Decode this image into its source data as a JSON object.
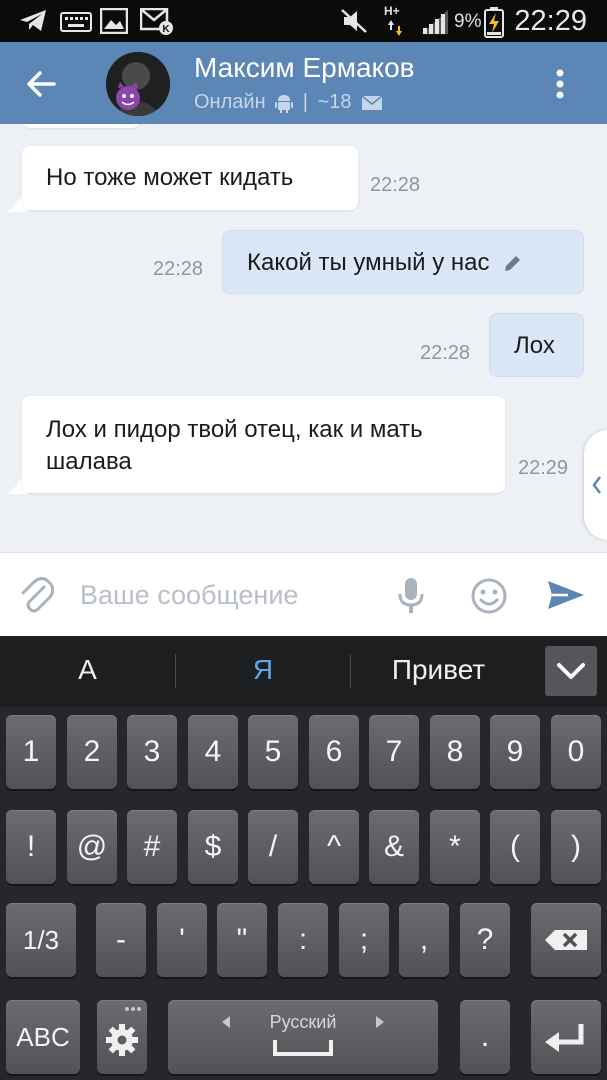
{
  "status_bar": {
    "icons": [
      "telegram-icon",
      "keyboard-icon",
      "image-icon",
      "vk-mail-icon",
      "mute-icon",
      "network-hplus-icon",
      "signal-icon",
      "battery-charging-icon"
    ],
    "network": "H+",
    "battery": "9%",
    "time": "22:29"
  },
  "header": {
    "contact_name": "Максим Ермаков",
    "status": "Онлайн",
    "separator": "|",
    "age": "~18",
    "colors": {
      "bar": "#5b86b6"
    }
  },
  "messages": [
    {
      "direction": "in",
      "text": "Но тоже может кидать",
      "time": "22:28"
    },
    {
      "direction": "out",
      "text": "Какой ты умный у нас",
      "time": "22:28",
      "edited": true
    },
    {
      "direction": "out",
      "text": "Лох",
      "time": "22:28"
    },
    {
      "direction": "in",
      "text": "Лох и пидор твой отец, как и мать шалава",
      "time": "22:29"
    }
  ],
  "composer": {
    "placeholder": "Ваше сообщение"
  },
  "suggestions": [
    "А",
    "Я",
    "Привет"
  ],
  "keyboard": {
    "row1": [
      "1",
      "2",
      "3",
      "4",
      "5",
      "6",
      "7",
      "8",
      "9",
      "0"
    ],
    "row2": [
      "!",
      "@",
      "#",
      "$",
      "/",
      "^",
      "&",
      "*",
      "(",
      ")"
    ],
    "row3": [
      "1/3",
      "-",
      "'",
      "\"",
      ":",
      ";",
      ",",
      "?"
    ],
    "abc": "ABC",
    "space_label": "Русский",
    "period": "."
  }
}
